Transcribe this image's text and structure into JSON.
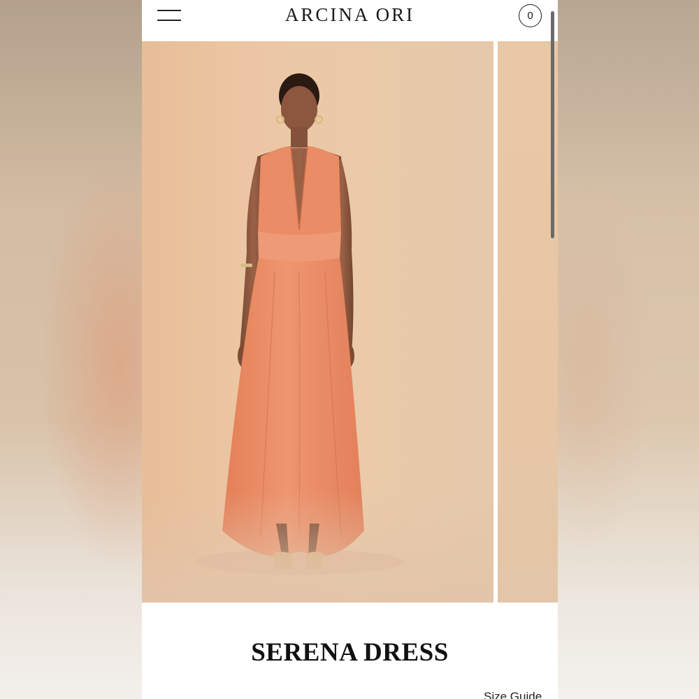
{
  "header": {
    "brand": "ARCINA ORI",
    "cart_count": "0",
    "menu_icon": "hamburger-icon",
    "cart_icon": "cart-badge-icon"
  },
  "gallery": {
    "image_alt": "Model wearing orange halter maxi dress"
  },
  "product": {
    "title": "SERENA DRESS",
    "size_guide_label": "Size Guide"
  },
  "colors": {
    "dress": "#e98a63",
    "backdrop": "#ecc6a4",
    "text": "#111111"
  }
}
